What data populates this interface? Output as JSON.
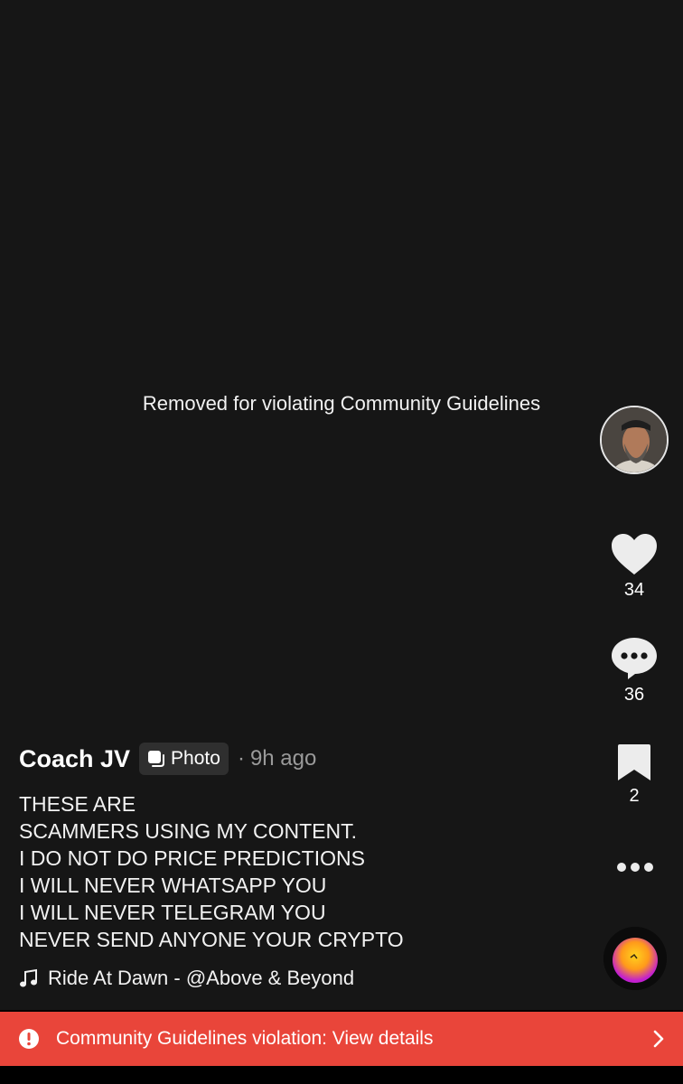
{
  "video": {
    "removed_message": "Removed for violating Community Guidelines"
  },
  "rail": {
    "avatar_icon": "creator-avatar",
    "likes": "34",
    "comments": "36",
    "saves": "2",
    "more_icon": "ellipsis-icon",
    "sound_icon": "sound-disc"
  },
  "post": {
    "author": "Coach JV",
    "badge": "Photo",
    "separator": "·",
    "time_ago": "9h ago",
    "caption_lines": [
      "THESE ARE",
      "SCAMMERS USING MY CONTENT.",
      "I DO NOT DO PRICE PREDICTIONS",
      "I WILL NEVER WHATSAPP YOU",
      "I WILL NEVER TELEGRAM YOU",
      "NEVER SEND ANYONE YOUR CRYPTO"
    ],
    "music": "Ride At Dawn - @Above & Beyond"
  },
  "violation": {
    "text": "Community Guidelines violation: View details"
  },
  "colors": {
    "background": "#161616",
    "banner": "#e9453a",
    "muted_text": "#9a9a9a"
  }
}
